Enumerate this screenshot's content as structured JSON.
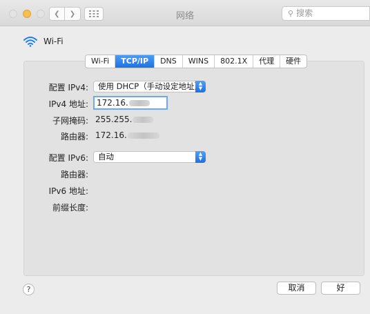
{
  "window": {
    "title": "网络",
    "search_placeholder": "搜索"
  },
  "interface": {
    "name": "Wi-Fi",
    "icon": "wifi-icon",
    "icon_color": "#1f7bf2"
  },
  "tabs": [
    {
      "label": "Wi-Fi",
      "active": false
    },
    {
      "label": "TCP/IP",
      "active": true
    },
    {
      "label": "DNS",
      "active": false
    },
    {
      "label": "WINS",
      "active": false
    },
    {
      "label": "802.1X",
      "active": false
    },
    {
      "label": "代理",
      "active": false
    },
    {
      "label": "硬件",
      "active": false
    }
  ],
  "ipv4": {
    "configure_label": "配置 IPv4:",
    "configure_value": "使用 DHCP（手动设定地址）",
    "address_label": "IPv4 地址:",
    "address_value": "172.16.",
    "subnet_label": "子网掩码:",
    "subnet_value": "255.255.",
    "router_label": "路由器:",
    "router_value": "172.16."
  },
  "ipv6": {
    "configure_label": "配置 IPv6:",
    "configure_value": "自动",
    "router_label": "路由器:",
    "address_label": "IPv6 地址:",
    "prefix_label": "前缀长度:"
  },
  "footer": {
    "help": "?",
    "cancel": "取消",
    "ok": "好"
  },
  "colors": {
    "accent": "#1f72e4"
  }
}
